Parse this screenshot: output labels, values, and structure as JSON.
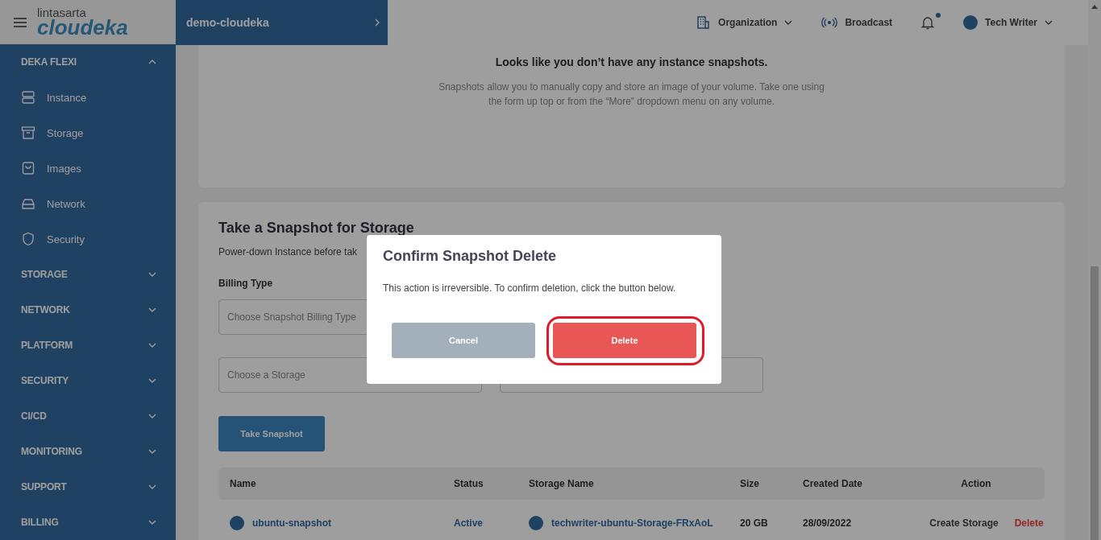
{
  "header": {
    "logo": {
      "top": "lintasarta",
      "brand": "cloudeka"
    },
    "project": "demo-cloudeka",
    "organization": "Organization",
    "broadcast": "Broadcast",
    "notification": {
      "unread": true
    },
    "user": "Tech Writer"
  },
  "sidebar": {
    "sections": [
      {
        "label": "DEKA FLEXI",
        "expanded": true,
        "children": [
          {
            "label": "Instance"
          },
          {
            "label": "Storage"
          },
          {
            "label": "Images"
          },
          {
            "label": "Network"
          },
          {
            "label": "Security"
          }
        ]
      },
      {
        "label": "STORAGE",
        "expanded": false
      },
      {
        "label": "NETWORK",
        "expanded": false
      },
      {
        "label": "PLATFORM",
        "expanded": false
      },
      {
        "label": "SECURITY",
        "expanded": false
      },
      {
        "label": "CI/CD",
        "expanded": false
      },
      {
        "label": "MONITORING",
        "expanded": false
      },
      {
        "label": "SUPPORT",
        "expanded": false
      },
      {
        "label": "BILLING",
        "expanded": false
      }
    ]
  },
  "empty_state": {
    "title": "Looks like you don’t have any instance snapshots.",
    "text": "Snapshots allow you to manually copy and store an image of your volume. Take one using the form up top or from the “More” dropdown menu on any volume."
  },
  "snapshot_form": {
    "title": "Take a Snapshot for Storage",
    "subtitle": "Power-down Instance before tak",
    "billing_label": "Billing Type",
    "billing_placeholder": "Choose Snapshot Billing Type",
    "storage_placeholder": "Choose a Storage",
    "submit": "Take Snapshot"
  },
  "table": {
    "columns": [
      "Name",
      "Status",
      "Storage Name",
      "Size",
      "Created Date",
      "Action"
    ],
    "rows": [
      {
        "name": "ubuntu-snapshot",
        "status": "Active",
        "storage_name": "techwriter-ubuntu-Storage-FRxAoL",
        "size": "20 GB",
        "created": "28/09/2022",
        "actions": [
          "Create Storage",
          "Delete"
        ]
      }
    ]
  },
  "dialog": {
    "title": "Confirm Snapshot Delete",
    "message": "This action is irreversible. To confirm deletion, click the button below.",
    "buttons": [
      {
        "label": "Cancel",
        "kind": "secondary"
      },
      {
        "label": "Delete",
        "kind": "danger",
        "highlighted": true
      }
    ]
  }
}
